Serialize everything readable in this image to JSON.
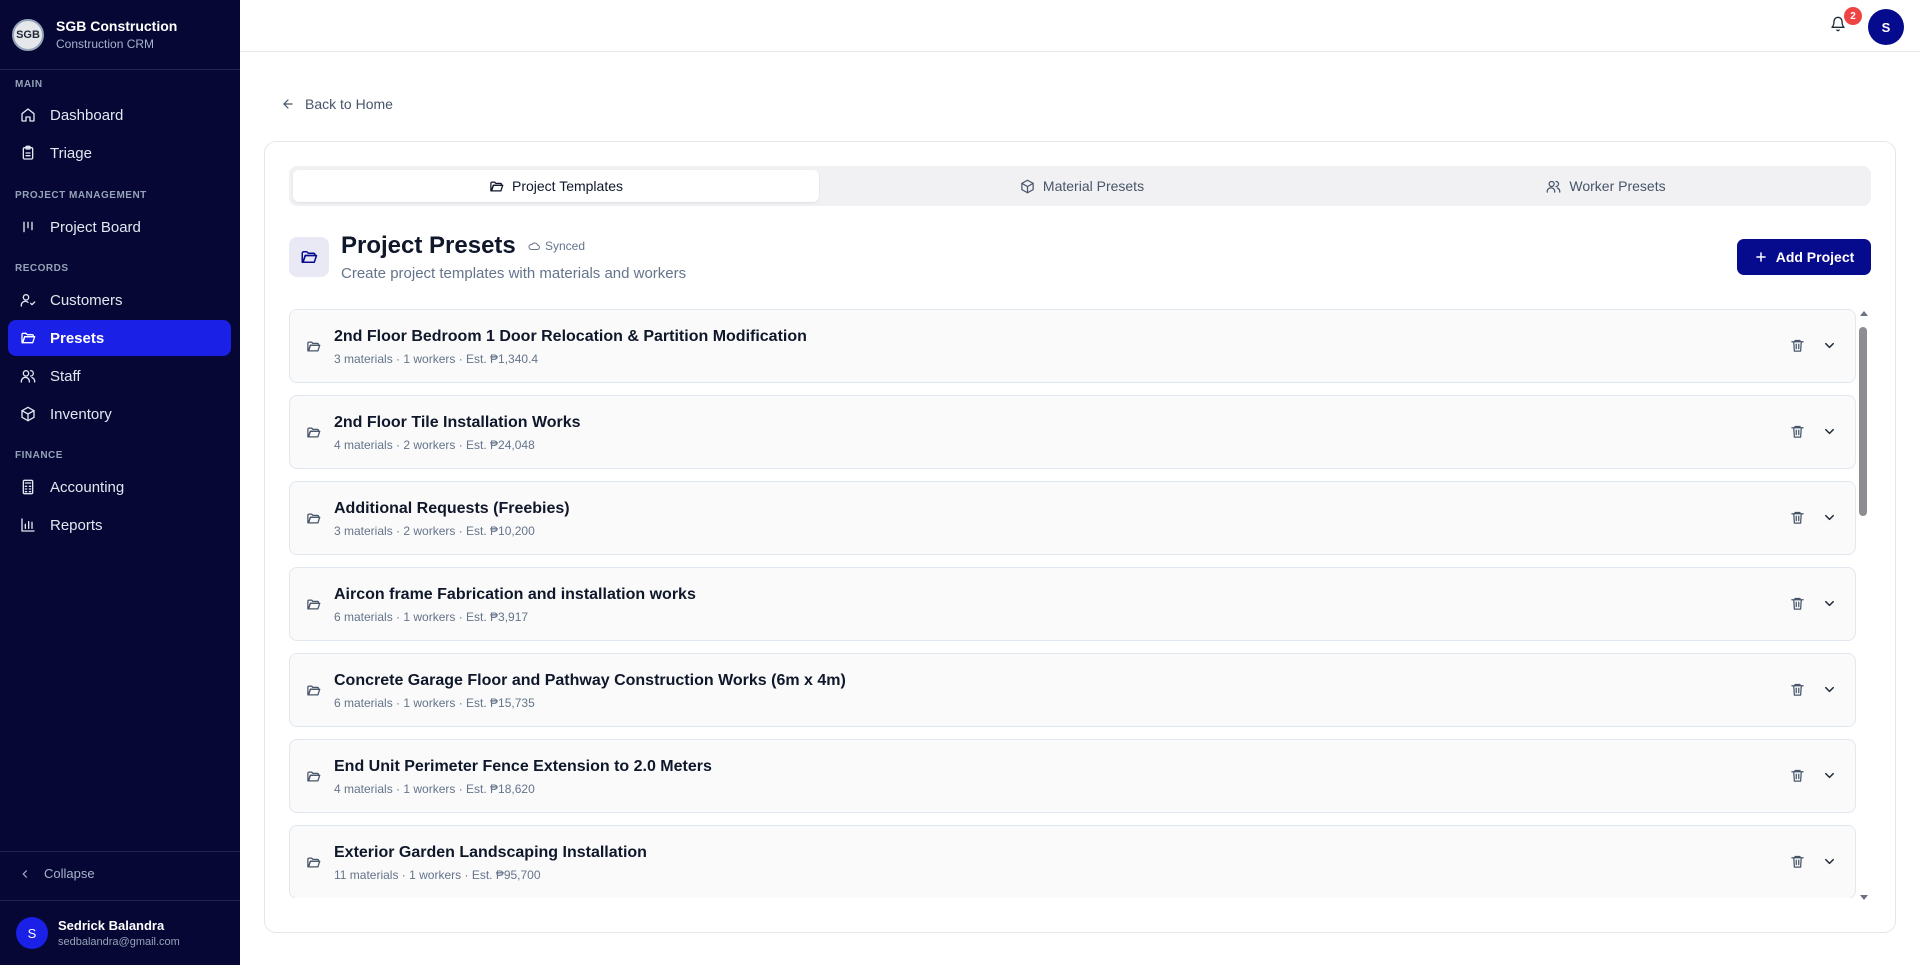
{
  "brand": {
    "logo_text": "SGB",
    "name": "SGB Construction",
    "subtitle": "Construction CRM"
  },
  "sidebar": {
    "sections": {
      "main": "MAIN",
      "project_management": "PROJECT MANAGEMENT",
      "records": "RECORDS",
      "finance": "FINANCE"
    },
    "items": [
      {
        "label": "Dashboard",
        "icon": "home-icon",
        "active": false
      },
      {
        "label": "Triage",
        "icon": "clipboard-icon",
        "active": false
      },
      {
        "label": "Project Board",
        "icon": "kanban-icon",
        "active": false
      },
      {
        "label": "Customers",
        "icon": "user-check-icon",
        "active": false
      },
      {
        "label": "Presets",
        "icon": "folder-open-icon",
        "active": true
      },
      {
        "label": "Staff",
        "icon": "users-icon",
        "active": false
      },
      {
        "label": "Inventory",
        "icon": "package-icon",
        "active": false
      },
      {
        "label": "Accounting",
        "icon": "calculator-icon",
        "active": false
      },
      {
        "label": "Reports",
        "icon": "bar-chart-icon",
        "active": false
      }
    ],
    "collapse_label": "Collapse",
    "user": {
      "initial": "S",
      "name": "Sedrick Balandra",
      "email": "sedbalandra@gmail.com"
    }
  },
  "topbar": {
    "notification_count": "2",
    "avatar_initial": "S"
  },
  "main": {
    "back_label": "Back to Home",
    "tabs": [
      {
        "label": "Project Templates",
        "icon": "folder-open-icon",
        "active": true
      },
      {
        "label": "Material Presets",
        "icon": "package-icon",
        "active": false
      },
      {
        "label": "Worker Presets",
        "icon": "users-icon",
        "active": false
      }
    ],
    "header": {
      "title": "Project Presets",
      "sync_status": "Synced",
      "subtitle": "Create project templates with materials and workers",
      "add_button": "Add Project"
    },
    "projects": [
      {
        "title": "2nd Floor Bedroom 1 Door Relocation & Partition Modification",
        "meta": "3 materials · 1 workers · Est. ₱1,340.4"
      },
      {
        "title": "2nd Floor Tile Installation Works",
        "meta": "4 materials · 2 workers · Est. ₱24,048"
      },
      {
        "title": "Additional Requests (Freebies)",
        "meta": "3 materials · 2 workers · Est. ₱10,200"
      },
      {
        "title": "Aircon frame Fabrication and installation works",
        "meta": "6 materials · 1 workers · Est. ₱3,917"
      },
      {
        "title": "Concrete Garage Floor and Pathway Construction Works (6m x 4m)",
        "meta": "6 materials · 1 workers · Est. ₱15,735"
      },
      {
        "title": "End Unit Perimeter Fence Extension to 2.0 Meters",
        "meta": "4 materials · 1 workers · Est. ₱18,620"
      },
      {
        "title": "Exterior Garden Landscaping Installation",
        "meta": "11 materials · 1 workers · Est. ₱95,700"
      }
    ]
  },
  "colors": {
    "sidebar_bg": "#060734",
    "active_nav": "#1a20e6",
    "primary_button": "#060a8c",
    "badge": "#ef4444"
  }
}
